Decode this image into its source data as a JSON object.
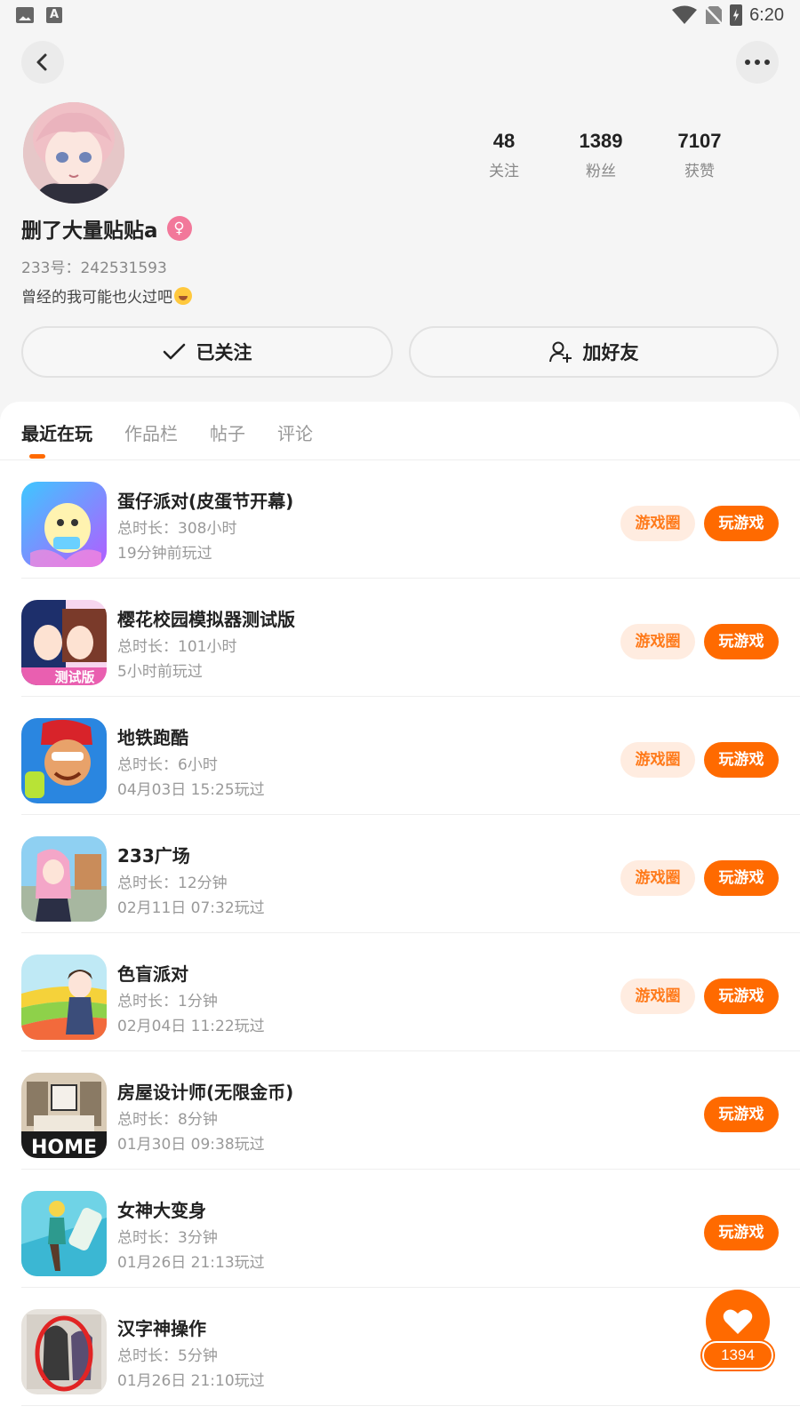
{
  "status_bar": {
    "time": "6:20",
    "icons": [
      "image-icon",
      "font-a-icon",
      "wifi-icon",
      "no-sim-icon",
      "battery-charging-icon"
    ]
  },
  "nav": {
    "back_icon": "back-chevron-icon",
    "more_icon": "more-dots-icon"
  },
  "profile": {
    "username": "删了大量贴贴a",
    "gender_icon": "female-icon",
    "gender_glyph": "♀",
    "user_id": "233号：242531593",
    "bio": "曾经的我可能也火过吧",
    "stats": [
      {
        "value": "48",
        "label": "关注"
      },
      {
        "value": "1389",
        "label": "粉丝"
      },
      {
        "value": "7107",
        "label": "获赞"
      }
    ],
    "follow_label": "已关注",
    "add_friend_label": "加好友"
  },
  "tabs": [
    {
      "label": "最近在玩",
      "active": true
    },
    {
      "label": "作品栏",
      "active": false
    },
    {
      "label": "帖子",
      "active": false
    },
    {
      "label": "评论",
      "active": false
    }
  ],
  "games": [
    {
      "name": "蛋仔派对(皮蛋节开幕)",
      "duration": "总时长：308小时",
      "last_played": "19分钟前玩过",
      "circle_label": "游戏圈",
      "play_label": "玩游戏"
    },
    {
      "name": "樱花校园模拟器测试版",
      "duration": "总时长：101小时",
      "last_played": "5小时前玩过",
      "circle_label": "游戏圈",
      "play_label": "玩游戏"
    },
    {
      "name": "地铁跑酷",
      "duration": "总时长：6小时",
      "last_played": "04月03日 15:25玩过",
      "circle_label": "游戏圈",
      "play_label": "玩游戏"
    },
    {
      "name": "233广场",
      "duration": "总时长：12分钟",
      "last_played": "02月11日 07:32玩过",
      "circle_label": "游戏圈",
      "play_label": "玩游戏"
    },
    {
      "name": "色盲派对",
      "duration": "总时长：1分钟",
      "last_played": "02月04日 11:22玩过",
      "circle_label": "游戏圈",
      "play_label": "玩游戏"
    },
    {
      "name": "房屋设计师(无限金币)",
      "duration": "总时长：8分钟",
      "last_played": "01月30日 09:38玩过",
      "play_label": "玩游戏",
      "icon_text": "HOME"
    },
    {
      "name": "女神大变身",
      "duration": "总时长：3分钟",
      "last_played": "01月26日 21:13玩过",
      "play_label": "玩游戏"
    },
    {
      "name": "汉字神操作",
      "duration": "总时长：5分钟",
      "last_played": "01月26日 21:10玩过"
    }
  ],
  "icon_badges": {
    "sakura_badge": "测试版"
  },
  "floating_like": {
    "count": "1394",
    "icon": "heart-icon"
  },
  "colors": {
    "accent": "#ff6a00",
    "circle_bg": "#ffece0",
    "circle_text": "#ff7a1a",
    "gender_pink": "#f2789a"
  }
}
